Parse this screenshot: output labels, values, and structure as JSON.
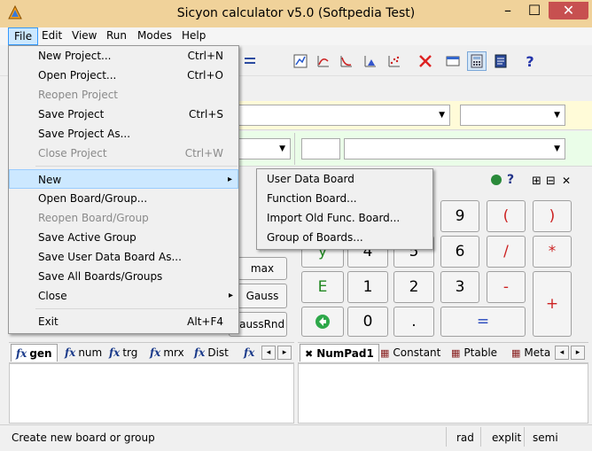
{
  "window": {
    "title": "Sicyon calculator v5.0 (Softpedia Test)",
    "minimize_glyph": "–",
    "maximize_glyph": "☐",
    "close_glyph": "✕"
  },
  "menubar": [
    "File",
    "Edit",
    "View",
    "Run",
    "Modes",
    "Help"
  ],
  "file_menu": {
    "items": [
      {
        "label": "New Project...",
        "shortcut": "Ctrl+N"
      },
      {
        "label": "Open Project...",
        "shortcut": "Ctrl+O"
      },
      {
        "label": "Reopen Project",
        "shortcut": ""
      },
      {
        "label": "Save Project",
        "shortcut": "Ctrl+S"
      },
      {
        "label": "Save Project As...",
        "shortcut": ""
      },
      {
        "label": "Close Project",
        "shortcut": "Ctrl+W"
      },
      {
        "label": "New",
        "shortcut": "▸"
      },
      {
        "label": "Open Board/Group...",
        "shortcut": ""
      },
      {
        "label": "Reopen Board/Group",
        "shortcut": ""
      },
      {
        "label": "Save Active Group",
        "shortcut": ""
      },
      {
        "label": "Save User Data Board As...",
        "shortcut": ""
      },
      {
        "label": "Save All Boards/Groups",
        "shortcut": ""
      },
      {
        "label": "Close",
        "shortcut": "▸"
      },
      {
        "label": "Exit",
        "shortcut": "Alt+F4"
      }
    ]
  },
  "new_submenu": [
    "User Data Board",
    "Function Board...",
    "Import Old Func. Board...",
    "Group of Boards..."
  ],
  "left_buttons": [
    "max",
    "Gauss",
    "GaussRnd"
  ],
  "pad": {
    "keys": [
      "9",
      "(",
      ")",
      "y",
      "4",
      "5",
      "6",
      "/",
      "*",
      "E",
      "1",
      "2",
      "3",
      "-",
      "+",
      "0",
      ".",
      "="
    ],
    "header_icons": [
      "?",
      "⊞",
      "⊟",
      "✕"
    ]
  },
  "left_tabs": [
    "gen",
    "num",
    "trg",
    "mrx",
    "Dist",
    ""
  ],
  "right_tabs": [
    "NumPad1",
    "Constant",
    "Ptable",
    "Meta"
  ],
  "tab_scroll": [
    "◂",
    "▸"
  ],
  "status": {
    "message": "Create new board or group",
    "angle": "rad",
    "mode": "explit",
    "sep": "semi"
  },
  "colors": {
    "titlebar": "#f0d29a",
    "close_button": "#c75050",
    "menu_highlight": "#cce8ff",
    "yellow_row": "#fffbd8",
    "green_row": "#eafde8"
  }
}
